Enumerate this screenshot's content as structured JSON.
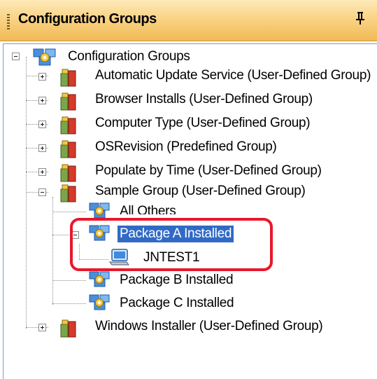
{
  "panel": {
    "title": "Configuration Groups",
    "pin_glyph": "p"
  },
  "tree": {
    "root": {
      "label": "Configuration Groups",
      "icon": "config-groups-icon",
      "expanded": true
    },
    "groups": [
      {
        "label": "Automatic Update Service (User-Defined Group)",
        "expanded": false
      },
      {
        "label": "Browser Installs (User-Defined Group)",
        "expanded": false
      },
      {
        "label": "Computer Type (User-Defined Group)",
        "expanded": false
      },
      {
        "label": "OSRevision (Predefined Group)",
        "expanded": false
      },
      {
        "label": "Populate by Time (User-Defined Group)",
        "expanded": false
      },
      {
        "label": "Sample Group (User-Defined Group)",
        "expanded": true
      },
      {
        "label": "Windows Installer (User-Defined Group)",
        "expanded": false
      }
    ],
    "sample_children": [
      {
        "label": "All Others"
      },
      {
        "label": "Package A Installed",
        "selected": true,
        "expanded": true
      },
      {
        "label": "Package B Installed"
      },
      {
        "label": "Package C Installed"
      }
    ],
    "package_a_children": [
      {
        "label": "JNTEST1",
        "icon": "computer-icon"
      }
    ]
  },
  "colors": {
    "header_gradient_top": "#fde9b8",
    "header_gradient_bottom": "#f1b956",
    "selection": "#316ac5",
    "highlight_callout": "#e8182a"
  }
}
